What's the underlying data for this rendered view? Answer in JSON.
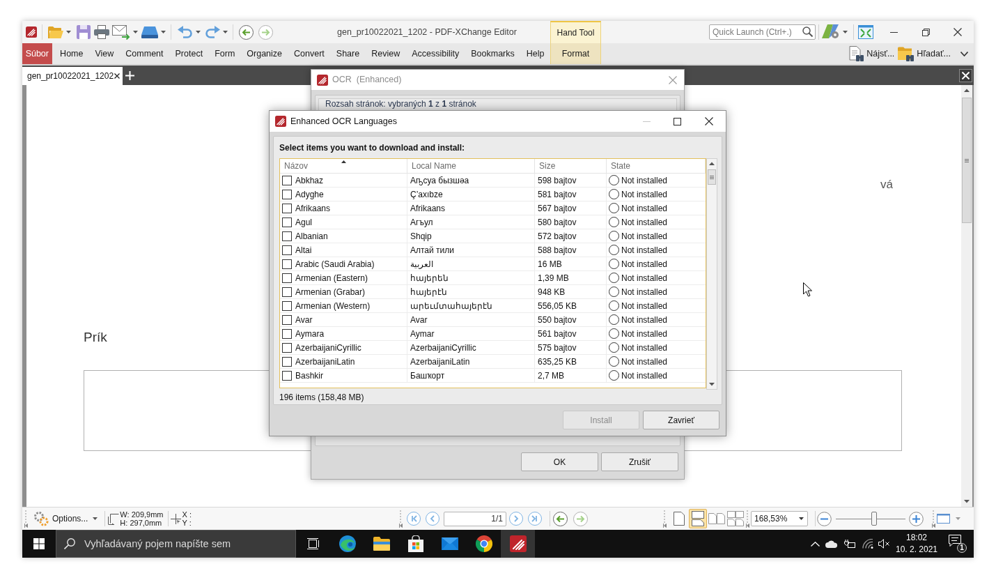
{
  "title_bar": {
    "quick_access": [
      {
        "kind": "open",
        "dropdown": true
      },
      {
        "kind": "save",
        "dropdown": false
      },
      {
        "kind": "print",
        "dropdown": false
      },
      {
        "kind": "email",
        "dropdown": true
      },
      {
        "kind": "scan",
        "dropdown": true
      },
      {
        "kind": "undo",
        "dropdown": true
      },
      {
        "kind": "redo",
        "dropdown": true
      },
      {
        "kind": "back",
        "dropdown": false
      },
      {
        "kind": "forward",
        "dropdown": false
      }
    ],
    "title": "gen_pr10022021_1202 - PDF-XChange Editor",
    "context_group": "Hand Tool",
    "quick_launch": {
      "placeholder": "Quick Launch (Ctrl+.)"
    }
  },
  "menu": [
    {
      "label": "Súbor",
      "kind": "file"
    },
    {
      "label": "Home",
      "kind": "tab"
    },
    {
      "label": "View",
      "kind": "tab"
    },
    {
      "label": "Comment",
      "kind": "tab"
    },
    {
      "label": "Protect",
      "kind": "tab"
    },
    {
      "label": "Form",
      "kind": "tab"
    },
    {
      "label": "Organize",
      "kind": "tab"
    },
    {
      "label": "Convert",
      "kind": "tab"
    },
    {
      "label": "Share",
      "kind": "tab"
    },
    {
      "label": "Review",
      "kind": "tab"
    },
    {
      "label": "Accessibility",
      "kind": "tab"
    },
    {
      "label": "Bookmarks",
      "kind": "tab"
    },
    {
      "label": "Help",
      "kind": "tab"
    },
    {
      "label": "Format",
      "kind": "context"
    }
  ],
  "ribbon_commands": [
    {
      "label": "Nájsť...",
      "kind": "find"
    },
    {
      "label": "Hľadať...",
      "kind": "search"
    }
  ],
  "document_tabs": [
    {
      "label": "gen_pr10022021_1202",
      "selected": true
    }
  ],
  "page": {
    "visible_texts": [
      "vá",
      "Prík"
    ]
  },
  "ocr_dialog": {
    "title": "OCR  (Enhanced)",
    "active": false,
    "page_range": "Rozsah stránok: vybraných **1** z **1** stránok",
    "buttons": [
      "OK",
      "Zrušiť"
    ]
  },
  "languages_dialog": {
    "title": "Enhanced OCR Languages",
    "active": true,
    "controls": [
      {
        "kind": "minimize",
        "disabled": true
      },
      {
        "kind": "maximize",
        "disabled": false
      },
      {
        "kind": "close",
        "disabled": false
      }
    ],
    "instruction": "Select items you want to download and install:",
    "columns": [
      {
        "label": "Názov",
        "sorted": true
      },
      {
        "label": "Local Name",
        "sorted": false
      },
      {
        "label": "Size",
        "sorted": false
      },
      {
        "label": "State",
        "sorted": false
      }
    ],
    "rows": [
      {
        "name": "Abkhaz",
        "local_name": "Аҧсуа бызшәа",
        "size": "598 bajtov",
        "state": "Not installed",
        "checked": false
      },
      {
        "name": "Adyghe",
        "local_name": "Ç’axıbze",
        "size": "581 bajtov",
        "state": "Not installed",
        "checked": false
      },
      {
        "name": "Afrikaans",
        "local_name": "Afrikaans",
        "size": "567 bajtov",
        "state": "Not installed",
        "checked": false
      },
      {
        "name": "Agul",
        "local_name": "Агъул",
        "size": "580 bajtov",
        "state": "Not installed",
        "checked": false
      },
      {
        "name": "Albanian",
        "local_name": "Shqip",
        "size": "572 bajtov",
        "state": "Not installed",
        "checked": false
      },
      {
        "name": "Altai",
        "local_name": "Алтай тили",
        "size": "588 bajtov",
        "state": "Not installed",
        "checked": false
      },
      {
        "name": "Arabic (Saudi Arabia)",
        "local_name": "العربية",
        "size": "16 MB",
        "state": "Not installed",
        "checked": false
      },
      {
        "name": "Armenian (Eastern)",
        "local_name": "հայերեն",
        "size": "1,39 MB",
        "state": "Not installed",
        "checked": false
      },
      {
        "name": "Armenian (Grabar)",
        "local_name": "հայերէն",
        "size": "948 KB",
        "state": "Not installed",
        "checked": false
      },
      {
        "name": "Armenian (Western)",
        "local_name": "արեւմտահայերէն",
        "size": "556,05 KB",
        "state": "Not installed",
        "checked": false
      },
      {
        "name": "Avar",
        "local_name": "Avar",
        "size": "550 bajtov",
        "state": "Not installed",
        "checked": false
      },
      {
        "name": "Aymara",
        "local_name": "Aymar",
        "size": "561 bajtov",
        "state": "Not installed",
        "checked": false
      },
      {
        "name": "AzerbaijaniCyrillic",
        "local_name": "AzerbaijaniCyrillic",
        "size": "575 bajtov",
        "state": "Not installed",
        "checked": false
      },
      {
        "name": "AzerbaijaniLatin",
        "local_name": "AzerbaijaniLatin",
        "size": "635,25 KB",
        "state": "Not installed",
        "checked": false
      },
      {
        "name": "Bashkir",
        "local_name": "Башҡорт",
        "size": "2,7 MB",
        "state": "Not installed",
        "checked": false
      }
    ],
    "summary": "196 items (158,48 MB)",
    "buttons": [
      {
        "label": "Install",
        "disabled": true
      },
      {
        "label": "Zavrieť",
        "disabled": false
      }
    ]
  },
  "status_bar": {
    "options": "Options...",
    "width": "W: 209,9mm",
    "height": "H: 297,0mm",
    "x": "X :",
    "y": "Y :",
    "page": "1/1",
    "page_layouts": [
      {
        "kind": "single",
        "selected": false
      },
      {
        "kind": "continuous",
        "selected": true
      },
      {
        "kind": "facing",
        "selected": false
      },
      {
        "kind": "facing-continuous",
        "selected": false
      }
    ],
    "zoom": "168,53%",
    "zoom_slider": {
      "level": 0.55
    }
  },
  "taskbar": {
    "search_placeholder": "Vyhľadávaný pojem napíšte sem",
    "apps": [
      {
        "kind": "task-view",
        "active": false
      },
      {
        "kind": "edge",
        "active": false
      },
      {
        "kind": "explorer",
        "active": false
      },
      {
        "kind": "store",
        "active": false
      },
      {
        "kind": "mail",
        "active": false
      },
      {
        "kind": "chrome",
        "active": false
      },
      {
        "kind": "pdf-editor",
        "active": true
      }
    ],
    "time": "18:02",
    "date": "10. 2. 2021",
    "notification_count": "1"
  }
}
